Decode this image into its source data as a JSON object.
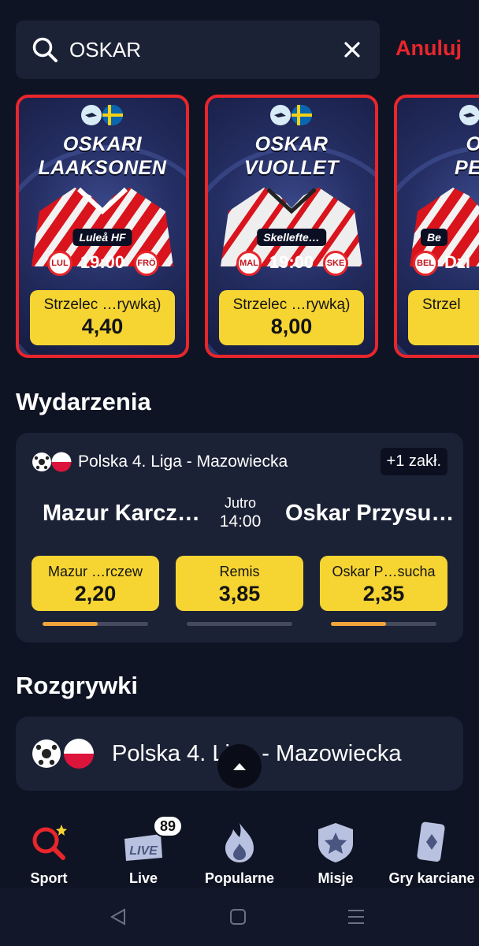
{
  "search": {
    "value": "OSKAR",
    "cancel_label": "Anuluj"
  },
  "player_cards": [
    {
      "first_name": "OSKARI",
      "last_name": "LAAKSONEN",
      "team": "Luleå HF",
      "home_abbr": "LUL",
      "away_abbr": "FRÖ",
      "time": "19:00",
      "market": "Strzelec …rywką)",
      "odd": "4,40",
      "jersey": "red"
    },
    {
      "first_name": "OSKAR",
      "last_name": "VUOLLET",
      "team": "Skellefte…",
      "home_abbr": "MAL",
      "away_abbr": "SKE",
      "time": "19:00",
      "market": "Strzelec …rywką)",
      "odd": "8,00",
      "jersey": "white"
    },
    {
      "first_name": "OS",
      "last_name": "PETT",
      "team": "Be",
      "home_abbr": "BEL",
      "away_abbr": "",
      "time": "Dzi",
      "market": "Strzel",
      "odd": "",
      "jersey": "red"
    }
  ],
  "events_section": {
    "title": "Wydarzenia"
  },
  "event": {
    "league": "Polska 4. Liga - Mazowiecka",
    "more_bets": "+1 zakł.",
    "home": "Mazur Karcz…",
    "away": "Oskar Przysu…",
    "day": "Jutro",
    "hour": "14:00",
    "odds": [
      {
        "label": "Mazur …rczew",
        "value": "2,20",
        "share": 0.52
      },
      {
        "label": "Remis",
        "value": "3,85",
        "share": 0.0
      },
      {
        "label": "Oskar P…sucha",
        "value": "2,35",
        "share": 0.52
      }
    ]
  },
  "competitions_section": {
    "title": "Rozgrywki"
  },
  "competition": {
    "name": "Polska 4. Liga - Mazowiecka"
  },
  "nav": [
    {
      "label": "Sport",
      "icon": "sport-icon",
      "active": true
    },
    {
      "label": "Live",
      "icon": "live-icon",
      "badge": "89"
    },
    {
      "label": "Popularne",
      "icon": "flame-icon"
    },
    {
      "label": "Misje",
      "icon": "star-badge-icon"
    },
    {
      "label": "Gry karciane",
      "icon": "card-icon"
    }
  ],
  "colors": {
    "accent_red": "#e8262c",
    "odd_yellow": "#f6d532",
    "bg": "#0f1424",
    "card_bg": "#1c2236",
    "progress": "#f0a53a"
  }
}
